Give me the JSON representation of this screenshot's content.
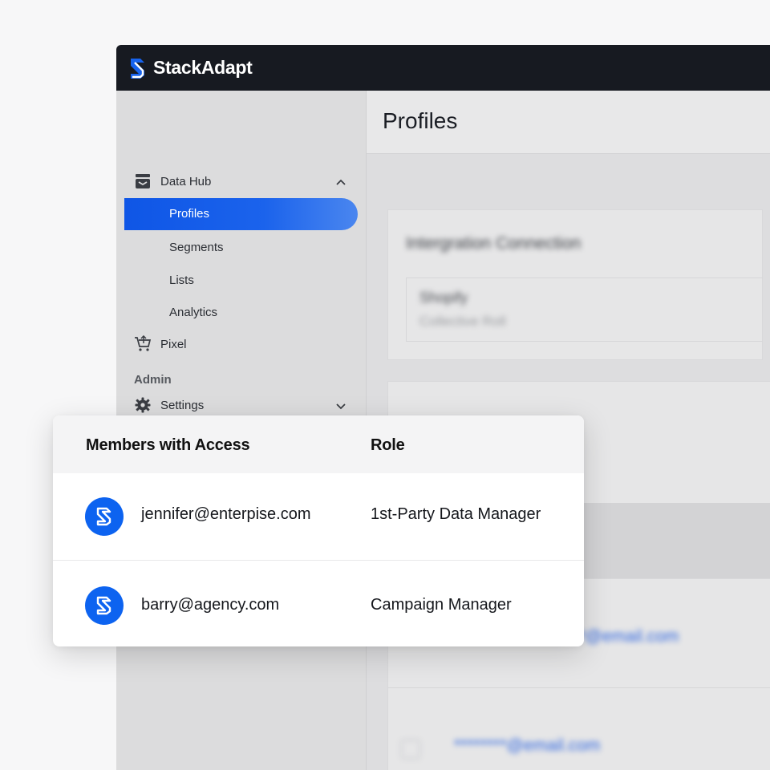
{
  "brand": {
    "name": "StackAdapt",
    "accent": "#1763ee",
    "topbar_color": "#171a21"
  },
  "sidebar": {
    "groups": [
      {
        "label": "Data Hub",
        "icon": "database-icon",
        "expanded": true,
        "items": [
          "Profiles",
          "Segments",
          "Lists",
          "Analytics"
        ],
        "active": "Profiles"
      },
      {
        "label": "Pixel",
        "icon": "cart-icon"
      }
    ],
    "section_label": "Admin",
    "settings": {
      "label": "Settings",
      "icon": "gear-icon",
      "expanded": false
    }
  },
  "main": {
    "title": "Profiles",
    "integration": {
      "title": "Intergration Connection",
      "name": "Shopify",
      "subtitle": "Collective Roll"
    },
    "emails": [
      "********@email.com",
      "********@email.com"
    ]
  },
  "access_popup": {
    "columns": [
      "Members with Access",
      "Role"
    ],
    "rows": [
      {
        "email": "jennifer@enterpise.com",
        "role": "1st-Party Data Manager"
      },
      {
        "email": "barry@agency.com",
        "role": "Campaign Manager"
      }
    ]
  }
}
